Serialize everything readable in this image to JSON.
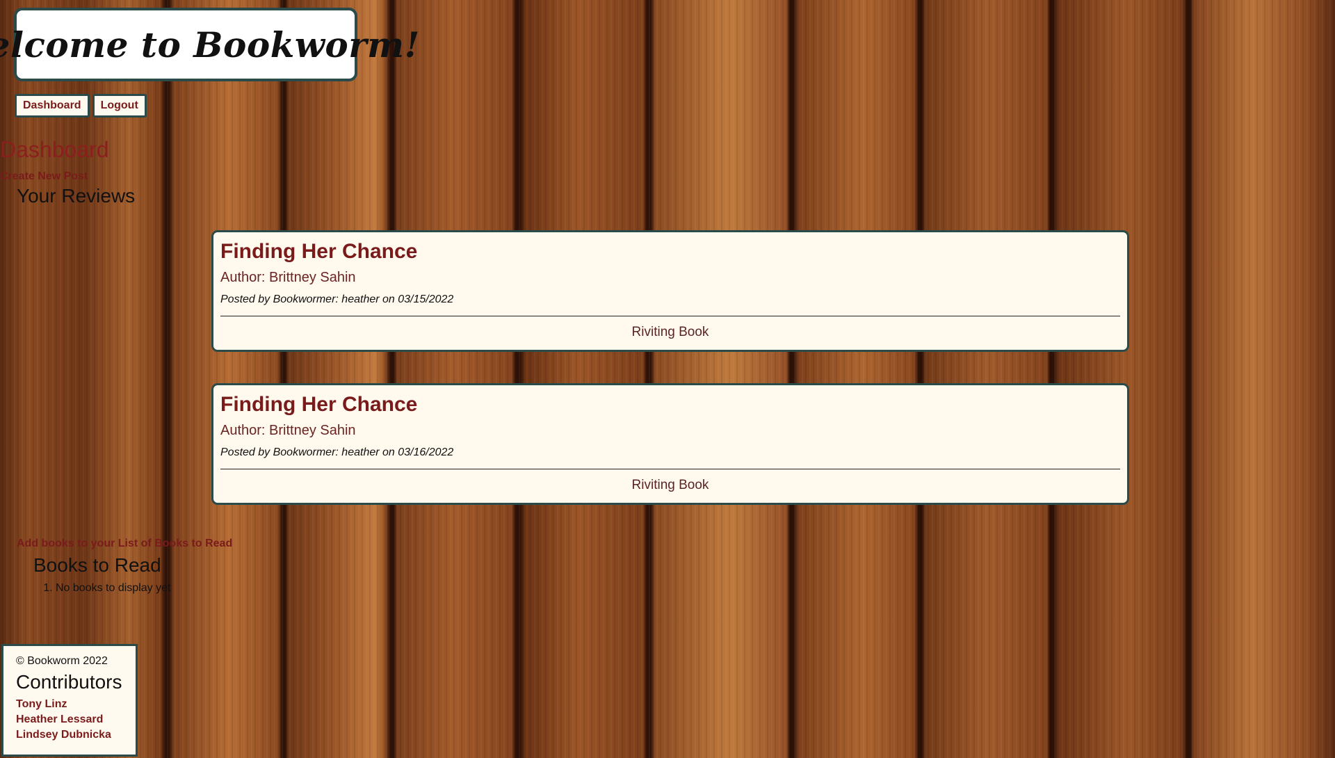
{
  "header": {
    "logo_text": "Welcome to Bookworm!"
  },
  "nav": {
    "dashboard_label": "Dashboard",
    "logout_label": "Logout"
  },
  "dashboard": {
    "title": "Dashboard",
    "create_post_label": "Create New Post",
    "reviews_heading": "Your Reviews"
  },
  "posts": [
    {
      "title": "Finding Her Chance",
      "author": "Author: Brittney Sahin",
      "meta": "Posted by Bookwormer: heather on 03/15/2022",
      "body": "Riviting Book"
    },
    {
      "title": "Finding Her Chance",
      "author": "Author: Brittney Sahin",
      "meta": "Posted by Bookwormer: heather on 03/16/2022",
      "body": "Riviting Book"
    }
  ],
  "books": {
    "add_link_label": "Add books to your List of Books to Read",
    "heading": "Books to Read",
    "items": [
      "No books to display yet"
    ]
  },
  "footer": {
    "copyright": "© Bookworm 2022",
    "contributors_heading": "Contributors",
    "contributors": [
      "Tony Linz",
      "Heather Lessard",
      "Lindsey Dubnicka"
    ]
  }
}
